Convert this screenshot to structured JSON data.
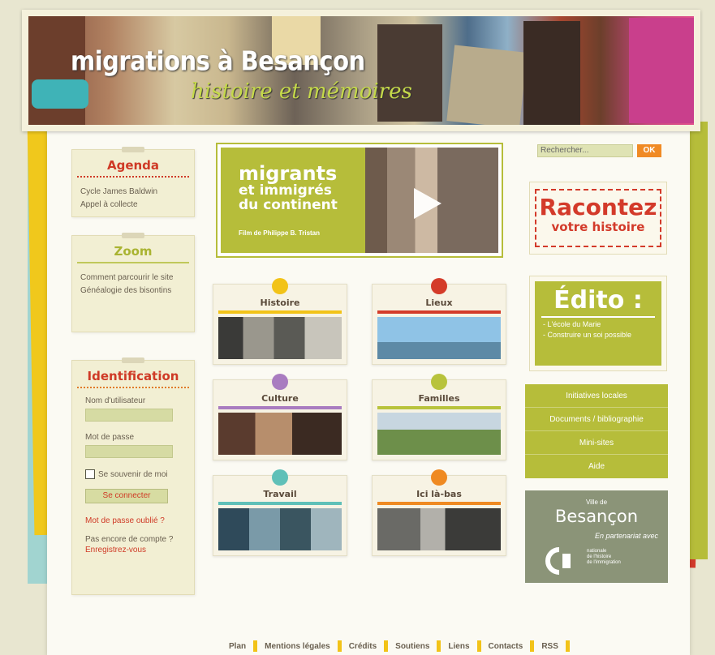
{
  "site": {
    "title": "migrations à Besançon",
    "subtitle": "histoire et mémoires"
  },
  "sidebar_left": {
    "agenda": {
      "title": "Agenda",
      "links": [
        "Cycle James Baldwin",
        "Appel à collecte"
      ]
    },
    "zoom": {
      "title": "Zoom",
      "links": [
        "Comment parcourir le site",
        "Généalogie des bisontins"
      ]
    },
    "login": {
      "title": "Identification",
      "username_label": "Nom d'utilisateur",
      "password_label": "Mot de passe",
      "remember_label": "Se souvenir de moi",
      "submit_label": "Se connecter",
      "forgot_label": "Mot de passe oublié ?",
      "no_account_text": "Pas encore de compte ?",
      "register_label": "Enregistrez-vous"
    }
  },
  "video": {
    "title_line1": "migrants",
    "title_line2": "et immigrés",
    "title_line3": "du continent",
    "credit": "Film de Philippe B. Tristan"
  },
  "themes": [
    {
      "label": "Histoire",
      "color": "#f2c318"
    },
    {
      "label": "Lieux",
      "color": "#d43c2a"
    },
    {
      "label": "Culture",
      "color": "#a97cc0"
    },
    {
      "label": "Familles",
      "color": "#b8c33c"
    },
    {
      "label": "Travail",
      "color": "#5fc0b8"
    },
    {
      "label": "Ici là-bas",
      "color": "#ef8a22"
    }
  ],
  "search": {
    "placeholder": "Rechercher...",
    "button_label": "OK"
  },
  "racontez": {
    "line1": "Racontez",
    "line2": "votre histoire"
  },
  "edito": {
    "title": "Édito :",
    "links": [
      "- L'école du Marie",
      "- Construire un soi possible"
    ]
  },
  "menu": [
    "Initiatives locales",
    "Documents / bibliographie",
    "Mini-sites",
    "Aide"
  ],
  "partner": {
    "ville": "Ville de",
    "city": "Besançon",
    "avec": "En partenariat avec",
    "cite": [
      "nationale",
      "de l'histoire",
      "de l'immigration"
    ]
  },
  "footer": [
    "Plan",
    "Mentions légales",
    "Crédits",
    "Soutiens",
    "Liens",
    "Contacts",
    "RSS"
  ],
  "footer_separator_color": "#f2c318"
}
